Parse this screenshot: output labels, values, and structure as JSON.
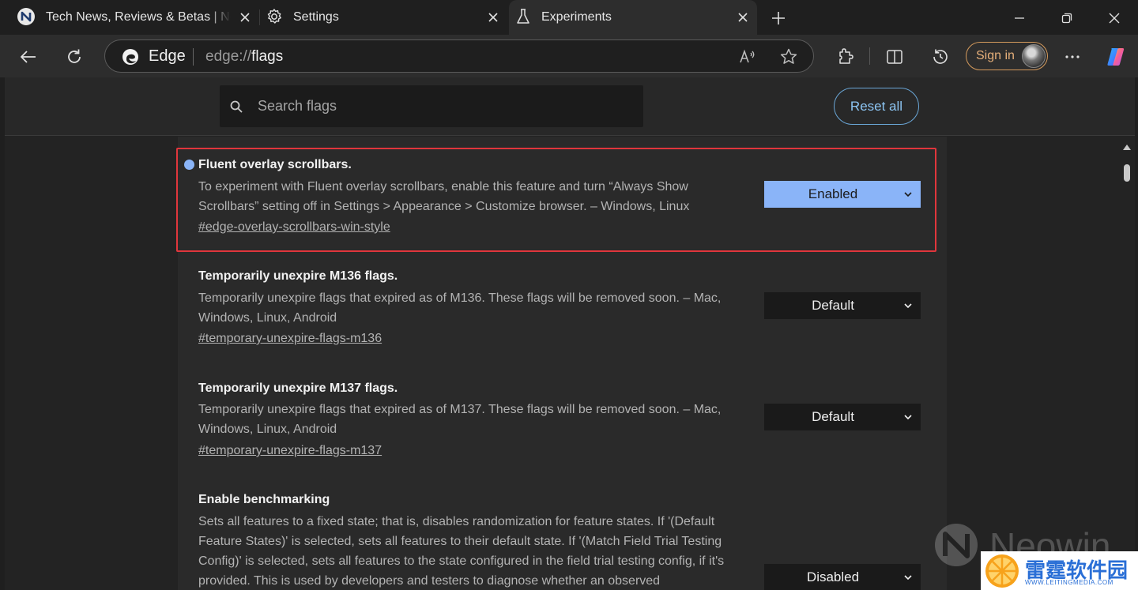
{
  "tabs": [
    {
      "title": "Tech News, Reviews & Betas | Neowin",
      "icon": "neowin-favicon"
    },
    {
      "title": "Settings",
      "icon": "gear-icon"
    },
    {
      "title": "Experiments",
      "icon": "beaker-icon",
      "active": true
    }
  ],
  "omnibox": {
    "brand": "Edge",
    "url_scheme": "edge://",
    "url_host": "flags"
  },
  "profile": {
    "signin_label": "Sign in"
  },
  "search": {
    "placeholder": "Search flags",
    "value": ""
  },
  "reset_label": "Reset all",
  "flags": [
    {
      "title": "Fluent overlay scrollbars.",
      "description": "To experiment with Fluent overlay scrollbars, enable this feature and turn “Always Show Scrollbars” setting off in Settings > Appearance > Customize browser. – Windows, Linux",
      "link": "#edge-overlay-scrollbars-win-style",
      "state": "Enabled",
      "modified": true
    },
    {
      "title": "Temporarily unexpire M136 flags.",
      "description": "Temporarily unexpire flags that expired as of M136. These flags will be removed soon. – Mac, Windows, Linux, Android",
      "link": "#temporary-unexpire-flags-m136",
      "state": "Default"
    },
    {
      "title": "Temporarily unexpire M137 flags.",
      "description": "Temporarily unexpire flags that expired as of M137. These flags will be removed soon. – Mac, Windows, Linux, Android",
      "link": "#temporary-unexpire-flags-m137",
      "state": "Default"
    },
    {
      "title": "Enable benchmarking",
      "description": "Sets all features to a fixed state; that is, disables randomization for feature states. If '(Default Feature States)' is selected, sets all features to their default state. If '(Match Field Trial Testing Config)' is selected, sets all features to the state configured in the field trial testing config, if it's provided. This is used by developers and testers to diagnose whether an observed",
      "state": "Disabled"
    }
  ],
  "watermarks": {
    "neowin": "Neowin",
    "leiting": "雷霆软件园",
    "leiting_url": "WWW.LEITINGMEDIA.COM"
  },
  "colors": {
    "accent": "#8ab4f8",
    "highlight_border": "#e0363c",
    "signin": "#e7b07a"
  }
}
